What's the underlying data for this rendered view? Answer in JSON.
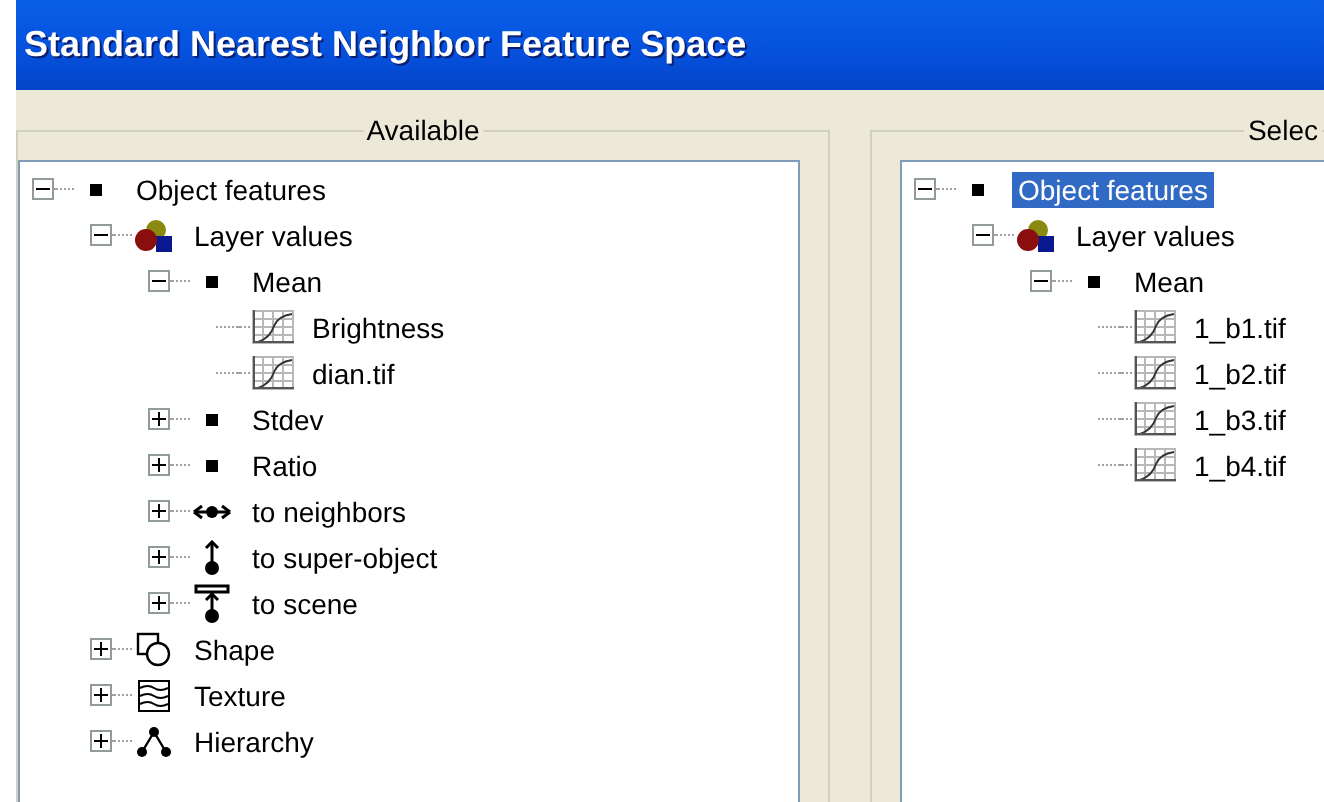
{
  "window": {
    "title": "Standard Nearest Neighbor Feature Space"
  },
  "available": {
    "title": "Available",
    "tree": [
      {
        "label": "Object features",
        "kind": "square",
        "expanded": true,
        "selected": false,
        "children": [
          {
            "label": "Layer values",
            "kind": "layers",
            "expanded": true,
            "selected": false,
            "children": [
              {
                "label": "Mean",
                "kind": "square",
                "expanded": true,
                "selected": false,
                "children": [
                  {
                    "label": "Brightness",
                    "kind": "feature",
                    "selected": false
                  },
                  {
                    "label": "dian.tif",
                    "kind": "feature",
                    "selected": false
                  }
                ]
              },
              {
                "label": "Stdev",
                "kind": "square",
                "expanded": false,
                "selected": false
              },
              {
                "label": "Ratio",
                "kind": "square",
                "expanded": false,
                "selected": false
              },
              {
                "label": "to neighbors",
                "kind": "neighbors",
                "expanded": false,
                "selected": false
              },
              {
                "label": "to super-object",
                "kind": "super",
                "expanded": false,
                "selected": false
              },
              {
                "label": "to scene",
                "kind": "scene",
                "expanded": false,
                "selected": false
              }
            ]
          },
          {
            "label": "Shape",
            "kind": "shape",
            "expanded": false,
            "selected": false
          },
          {
            "label": "Texture",
            "kind": "texture",
            "expanded": false,
            "selected": false
          },
          {
            "label": "Hierarchy",
            "kind": "hierarchy",
            "expanded": false,
            "selected": false
          }
        ]
      }
    ]
  },
  "selected_panel": {
    "title": "Selec",
    "tree": [
      {
        "label": "Object features",
        "kind": "square",
        "expanded": true,
        "selected": true,
        "children": [
          {
            "label": "Layer values",
            "kind": "layers",
            "expanded": true,
            "selected": false,
            "children": [
              {
                "label": "Mean",
                "kind": "square",
                "expanded": true,
                "selected": false,
                "children": [
                  {
                    "label": "1_b1.tif",
                    "kind": "feature",
                    "selected": false
                  },
                  {
                    "label": "1_b2.tif",
                    "kind": "feature",
                    "selected": false
                  },
                  {
                    "label": "1_b3.tif",
                    "kind": "feature",
                    "selected": false
                  },
                  {
                    "label": "1_b4.tif",
                    "kind": "feature",
                    "selected": false
                  }
                ]
              }
            ]
          }
        ]
      }
    ]
  }
}
